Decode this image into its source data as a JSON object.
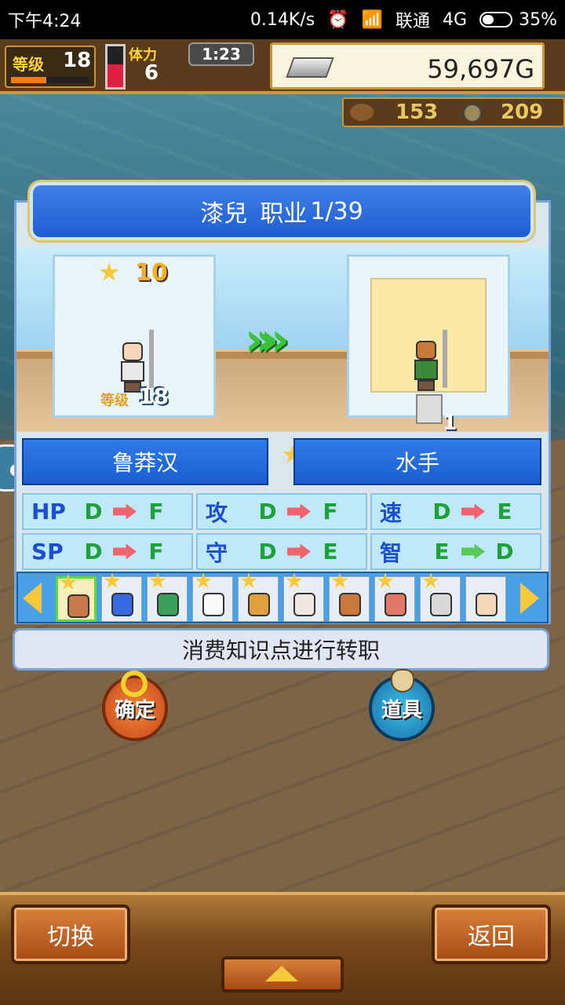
{
  "status_bar": {
    "time": "下午4:24",
    "speed": "0.14K/s",
    "carrier": "联通",
    "network": "4G",
    "battery": "35%"
  },
  "hud": {
    "level_label": "等级",
    "level": "18",
    "stamina_label": "体力",
    "stamina": "6",
    "timer": "1:23",
    "gold": "59,697G",
    "resource1": "153",
    "resource2": "209"
  },
  "panel": {
    "name": "漆兒",
    "job_label": "职业",
    "job_page": "1/39",
    "rank": "10",
    "level_tag": "等级",
    "level_num": "18",
    "item_count": "1",
    "arrows": "»»",
    "from_job": "鲁莽汉",
    "to_job": "水手"
  },
  "stats": [
    {
      "key": "HP",
      "from": "D",
      "to": "F",
      "dir": "down"
    },
    {
      "key": "攻",
      "from": "D",
      "to": "F",
      "dir": "down"
    },
    {
      "key": "速",
      "from": "D",
      "to": "E",
      "dir": "down"
    },
    {
      "key": "SP",
      "from": "D",
      "to": "F",
      "dir": "down"
    },
    {
      "key": "守",
      "from": "D",
      "to": "E",
      "dir": "down"
    },
    {
      "key": "智",
      "from": "E",
      "to": "D",
      "dir": "up"
    }
  ],
  "info_text": "消费知识点进行转职",
  "buttons": {
    "confirm": "确定",
    "items": "道具",
    "switch": "切换",
    "back": "返回"
  },
  "colors": {
    "panel_blue": "#1f5ed2",
    "stat_down": "#f06470",
    "stat_up": "#5ac85a",
    "star": "#f7c93a"
  }
}
